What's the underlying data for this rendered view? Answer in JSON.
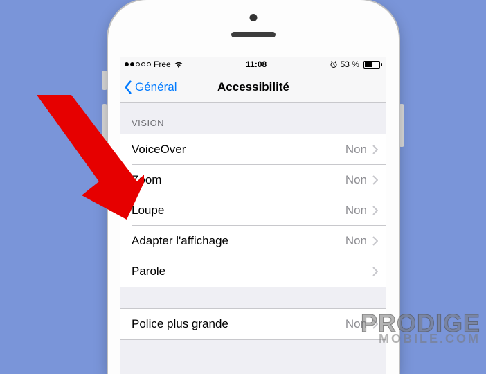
{
  "status_bar": {
    "carrier": "Free",
    "time": "11:08",
    "battery_percent": "53 %"
  },
  "nav": {
    "back_label": "Général",
    "title": "Accessibilité"
  },
  "section_header": "VISION",
  "rows": [
    {
      "label": "VoiceOver",
      "value": "Non"
    },
    {
      "label": "Zoom",
      "value": "Non"
    },
    {
      "label": "Loupe",
      "value": "Non"
    },
    {
      "label": "Adapter l'affichage",
      "value": "Non"
    },
    {
      "label": "Parole",
      "value": ""
    }
  ],
  "rows2": [
    {
      "label": "Police plus grande",
      "value": "Non"
    }
  ],
  "watermark": {
    "line1": "PRODIGE",
    "line2": "MOBILE.COM"
  }
}
